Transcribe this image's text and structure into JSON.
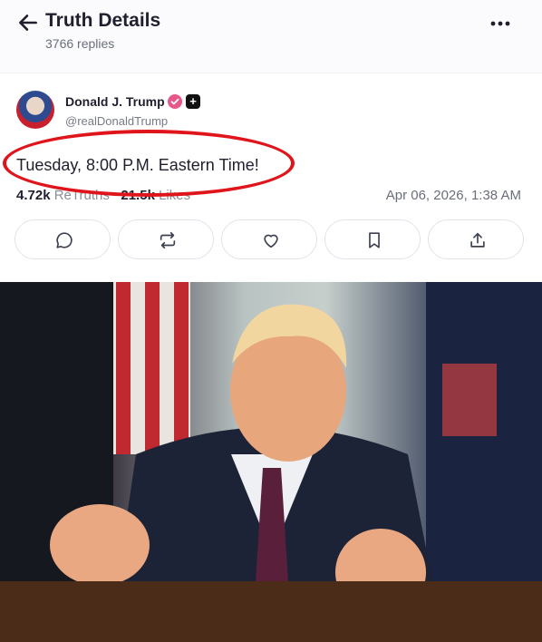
{
  "header": {
    "title": "Truth Details",
    "replies": "3766 replies"
  },
  "post": {
    "author_name": "Donald J. Trump",
    "handle": "@realDonaldTrump",
    "text": "Tuesday, 8:00 P.M. Eastern Time!",
    "retruths_count": "4.72k",
    "retruths_label": "ReTruths",
    "likes_count": "21.5k",
    "likes_label": "Likes",
    "date": "Apr 06, 2026, 1:38 AM"
  },
  "icons": [
    "back-arrow-icon",
    "more-dots-icon",
    "verified-icon",
    "plus-icon",
    "reply-icon",
    "retruth-icon",
    "like-icon",
    "bookmark-icon",
    "share-icon"
  ],
  "colors": {
    "verified": "#e8578a",
    "annotation": "#e0141b"
  }
}
